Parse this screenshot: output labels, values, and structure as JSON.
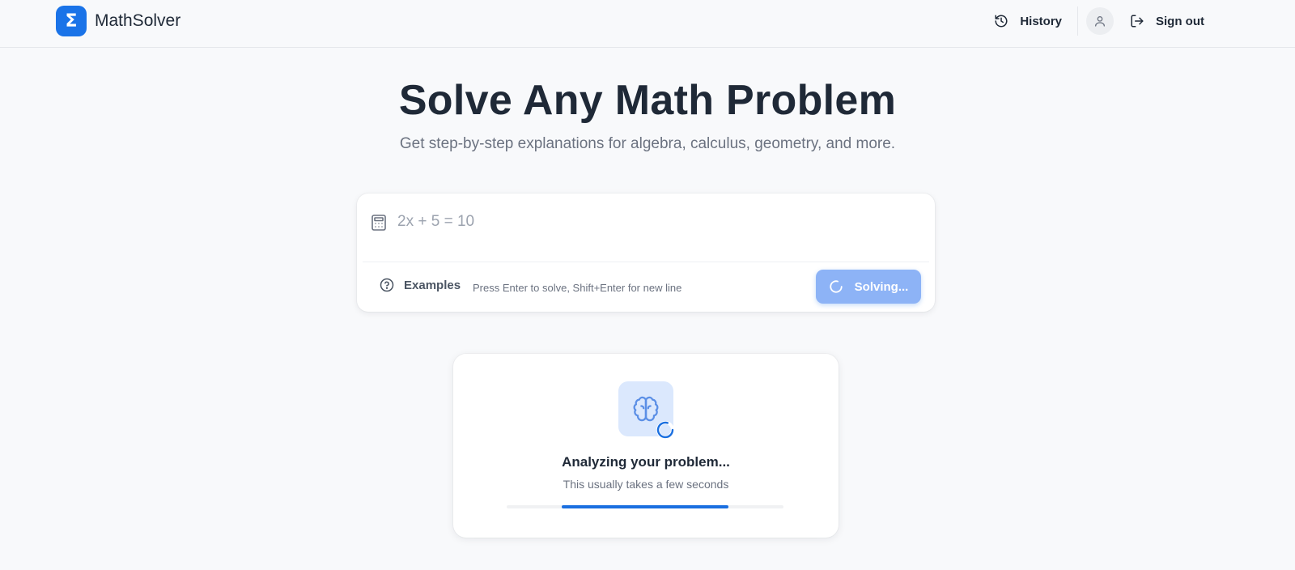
{
  "header": {
    "logo_symbol": "Σ",
    "app_name": "MathSolver",
    "history_label": "History",
    "signout_label": "Sign out"
  },
  "hero": {
    "title": "Solve Any Math Problem",
    "subtitle": "Get step-by-step explanations for algebra, calculus, geometry, and more."
  },
  "solver": {
    "input_placeholder": "2x + 5 = 10",
    "input_value": "",
    "examples_label": "Examples",
    "hint": "Press Enter to solve, Shift+Enter for new line",
    "solve_label": "Solving..."
  },
  "loading": {
    "title": "Analyzing your problem...",
    "subtitle": "This usually takes a few seconds",
    "progress_start": 0.2,
    "progress_end": 0.8
  },
  "icons": {
    "history": "history-icon",
    "user": "user-icon",
    "signout": "sign-out-icon",
    "calculator": "calculator-icon",
    "help": "help-circle-icon",
    "spinner": "spinner-icon",
    "brain": "brain-icon"
  },
  "colors": {
    "accent": "#1a73e8",
    "button_disabled": "#8db3f6",
    "brain_bg": "#dbe8fd",
    "progress": "#1a6fe0"
  }
}
